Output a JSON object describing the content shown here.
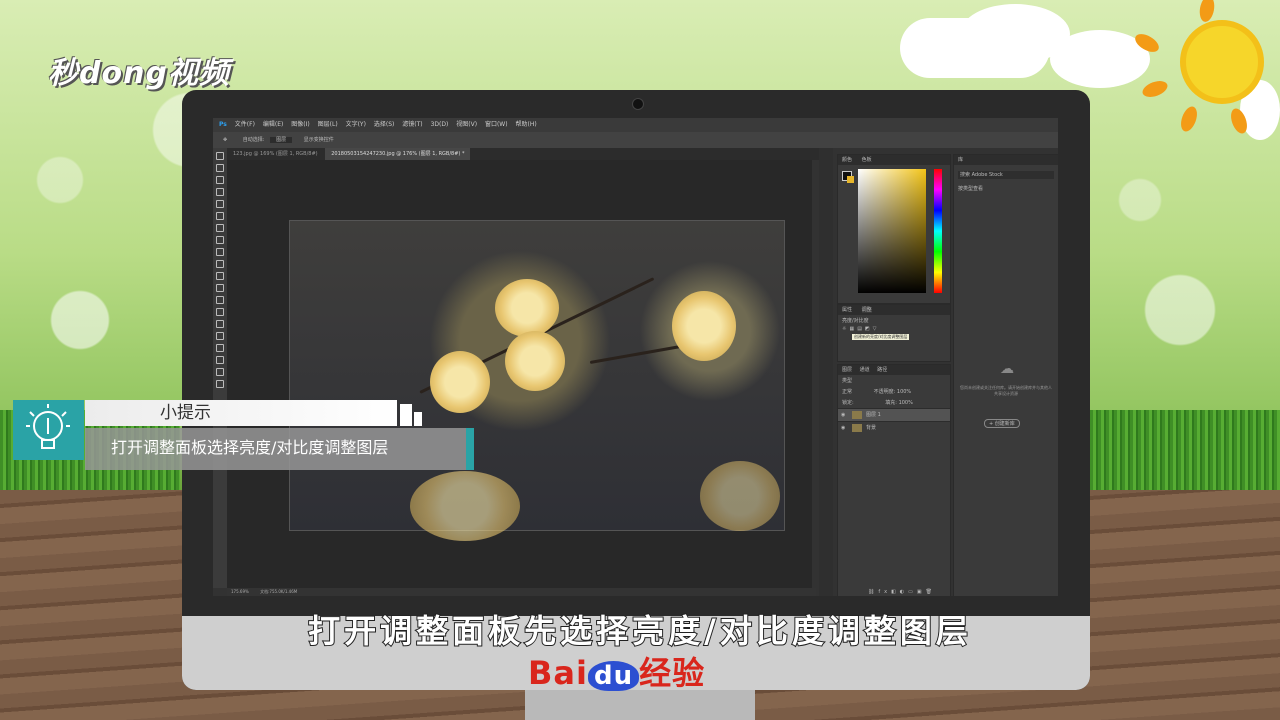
{
  "brand": {
    "logo_text": "秒dong视频"
  },
  "photoshop": {
    "menu": [
      "文件(F)",
      "编辑(E)",
      "图像(I)",
      "图层(L)",
      "文字(Y)",
      "选择(S)",
      "滤镜(T)",
      "3D(D)",
      "视图(V)",
      "窗口(W)",
      "帮助(H)"
    ],
    "options": {
      "auto_select": "自动选择:",
      "target": "图层",
      "show_transform": "显示变换控件"
    },
    "tabs": [
      {
        "label": "123.jpg @ 169% (图层 1, RGB/8#)",
        "active": false
      },
      {
        "label": "20180503154247230.jpg @ 176% (图层 1, RGB/8#) *",
        "active": true
      }
    ],
    "status": {
      "zoom": "175.69%",
      "doc": "文档:755.0K/1.46M"
    },
    "color_panel": {
      "tabs": [
        "颜色",
        "色板"
      ]
    },
    "adjust_panel": {
      "tabs": [
        "属性",
        "调整"
      ],
      "hint": "亮度/对比度",
      "tooltip": "创建新的亮度/对比度调整图层"
    },
    "layers_panel": {
      "tabs": [
        "图层",
        "通道",
        "路径"
      ],
      "kind": "类型",
      "blend": "正常",
      "opacity_label": "不透明度:",
      "opacity": "100%",
      "lock_label": "锁定:",
      "fill_label": "填充:",
      "fill": "100%",
      "layers": [
        {
          "name": "图层 1",
          "selected": true
        },
        {
          "name": "背景",
          "selected": false
        }
      ]
    },
    "library_panel": {
      "tab": "库",
      "search": "搜索 Adobe Stock",
      "filter": "按类型查看",
      "empty_text": "您尚未创建或关注任何库。请开始创建库并与其他人共享设计资源",
      "create_button": "+ 创建新库"
    }
  },
  "tip": {
    "title": "小提示",
    "body": "打开调整面板选择亮度/对比度调整图层"
  },
  "subtitle": "打开调整面板先选择亮度/对比度调整图层",
  "footer_brand": {
    "bai": "Bai",
    "du": "du",
    "jingyan": "经验"
  }
}
